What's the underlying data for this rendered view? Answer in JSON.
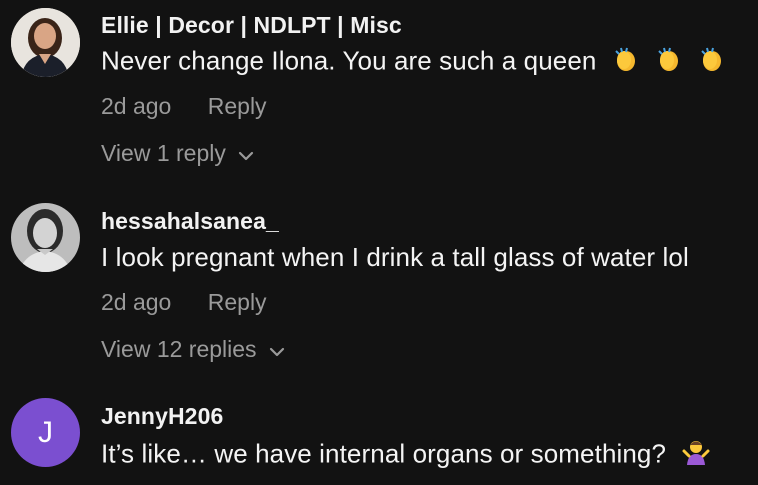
{
  "comments": [
    {
      "username": "Ellie | Decor | NDLPT | Misc",
      "text": "Never change Ilona. You are such a queen",
      "emoji": [
        "clapping-hands",
        "clapping-hands",
        "clapping-hands"
      ],
      "time": "2d ago",
      "reply_label": "Reply",
      "view_replies": "View 1 reply"
    },
    {
      "username": "hessahalsanea_",
      "text": "I look pregnant when I drink a tall glass of water lol",
      "time": "2d ago",
      "reply_label": "Reply",
      "view_replies": "View 12 replies"
    },
    {
      "username": "JennyH206",
      "avatar_letter": "J",
      "text": "It’s like… we have internal organs or something?",
      "emoji": [
        "person-shrugging"
      ]
    }
  ],
  "colors": {
    "background": "#121212",
    "text": "#f4f4f4",
    "muted": "#9a9a9a",
    "avatar_purple": "#7b4fd0"
  },
  "icons": [
    "chevron-down-icon"
  ]
}
